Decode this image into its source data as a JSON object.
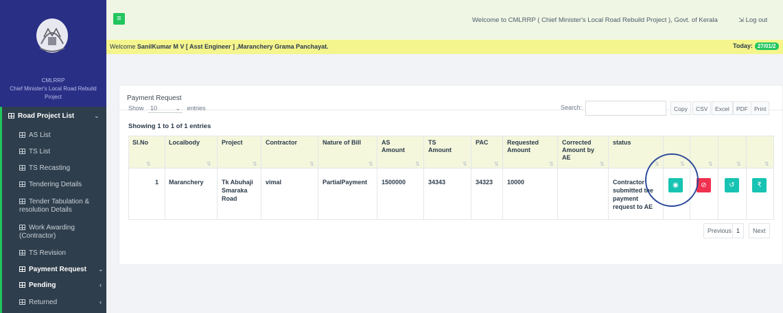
{
  "colors": {
    "brand": "#2a2f86",
    "accent": "#22c55e",
    "sidebar": "#2f3e4c",
    "danger": "#f0314f",
    "teal": "#17c3b2"
  },
  "sidebar": {
    "short_name": "CMLRRP",
    "full_name": "Chief Minister's Local Road Rebuild Project",
    "items": [
      {
        "label": "Road Project List",
        "icon": "grid-icon",
        "expanded": true
      },
      {
        "label": "AS List"
      },
      {
        "label": "TS List"
      },
      {
        "label": "TS Recasting"
      },
      {
        "label": "Tendering Details"
      },
      {
        "label": "Tender Tabulation & resolution Details"
      },
      {
        "label": "Work Awarding (Contractor)"
      },
      {
        "label": "TS Revision"
      },
      {
        "label": "Payment Request",
        "expanded": true
      },
      {
        "label": "Pending"
      },
      {
        "label": "Returned"
      }
    ]
  },
  "header": {
    "menu_icon": "hamburger-icon",
    "welcome": "Welcome to CMLRRP ( Chief Minister's Local Road Rebuild Project ), Govt. of Kerala",
    "logout": "Log out"
  },
  "userbar": {
    "prefix": "Welcome ",
    "user": "SanilKumar M V [ Asst Engineer ] ,Maranchery Grama Panchayat.",
    "today_label": "Today:",
    "today_value": "27/01/2"
  },
  "page": {
    "title": "Payment Request",
    "show_label": "Show",
    "entries_value": "10",
    "entries_label": "entries",
    "search_label": "Search:",
    "export_buttons": [
      "Copy",
      "CSV",
      "Excel",
      "PDF",
      "Print"
    ],
    "info": "Showing 1 to 1 of 1 entries"
  },
  "table": {
    "headers": [
      "Sl.No",
      "Localbody",
      "Project",
      "Contractor",
      "Nature of Bill",
      "AS Amount",
      "TS Amount",
      "PAC",
      "Requested Amount",
      "Corrected Amount by AE",
      "status"
    ],
    "rows": [
      {
        "slno": "1",
        "localbody": "Maranchery",
        "project": "Tk Abuhaji Smaraka Road",
        "contractor": "vimal",
        "nature": "PartialPayment",
        "as_amount": "1500000",
        "ts_amount": "34343",
        "pac": "34323",
        "requested": "10000",
        "corrected": "",
        "status": "Contractor submitted the payment request to AE"
      }
    ],
    "actions": [
      {
        "name": "view-icon",
        "glyph": "◉"
      },
      {
        "name": "reject-icon",
        "glyph": "⊘"
      },
      {
        "name": "return-icon",
        "glyph": "↺"
      },
      {
        "name": "rupee-icon",
        "glyph": "₹"
      }
    ]
  },
  "pagination": {
    "previous": "Previous",
    "page": "1",
    "next": "Next"
  }
}
